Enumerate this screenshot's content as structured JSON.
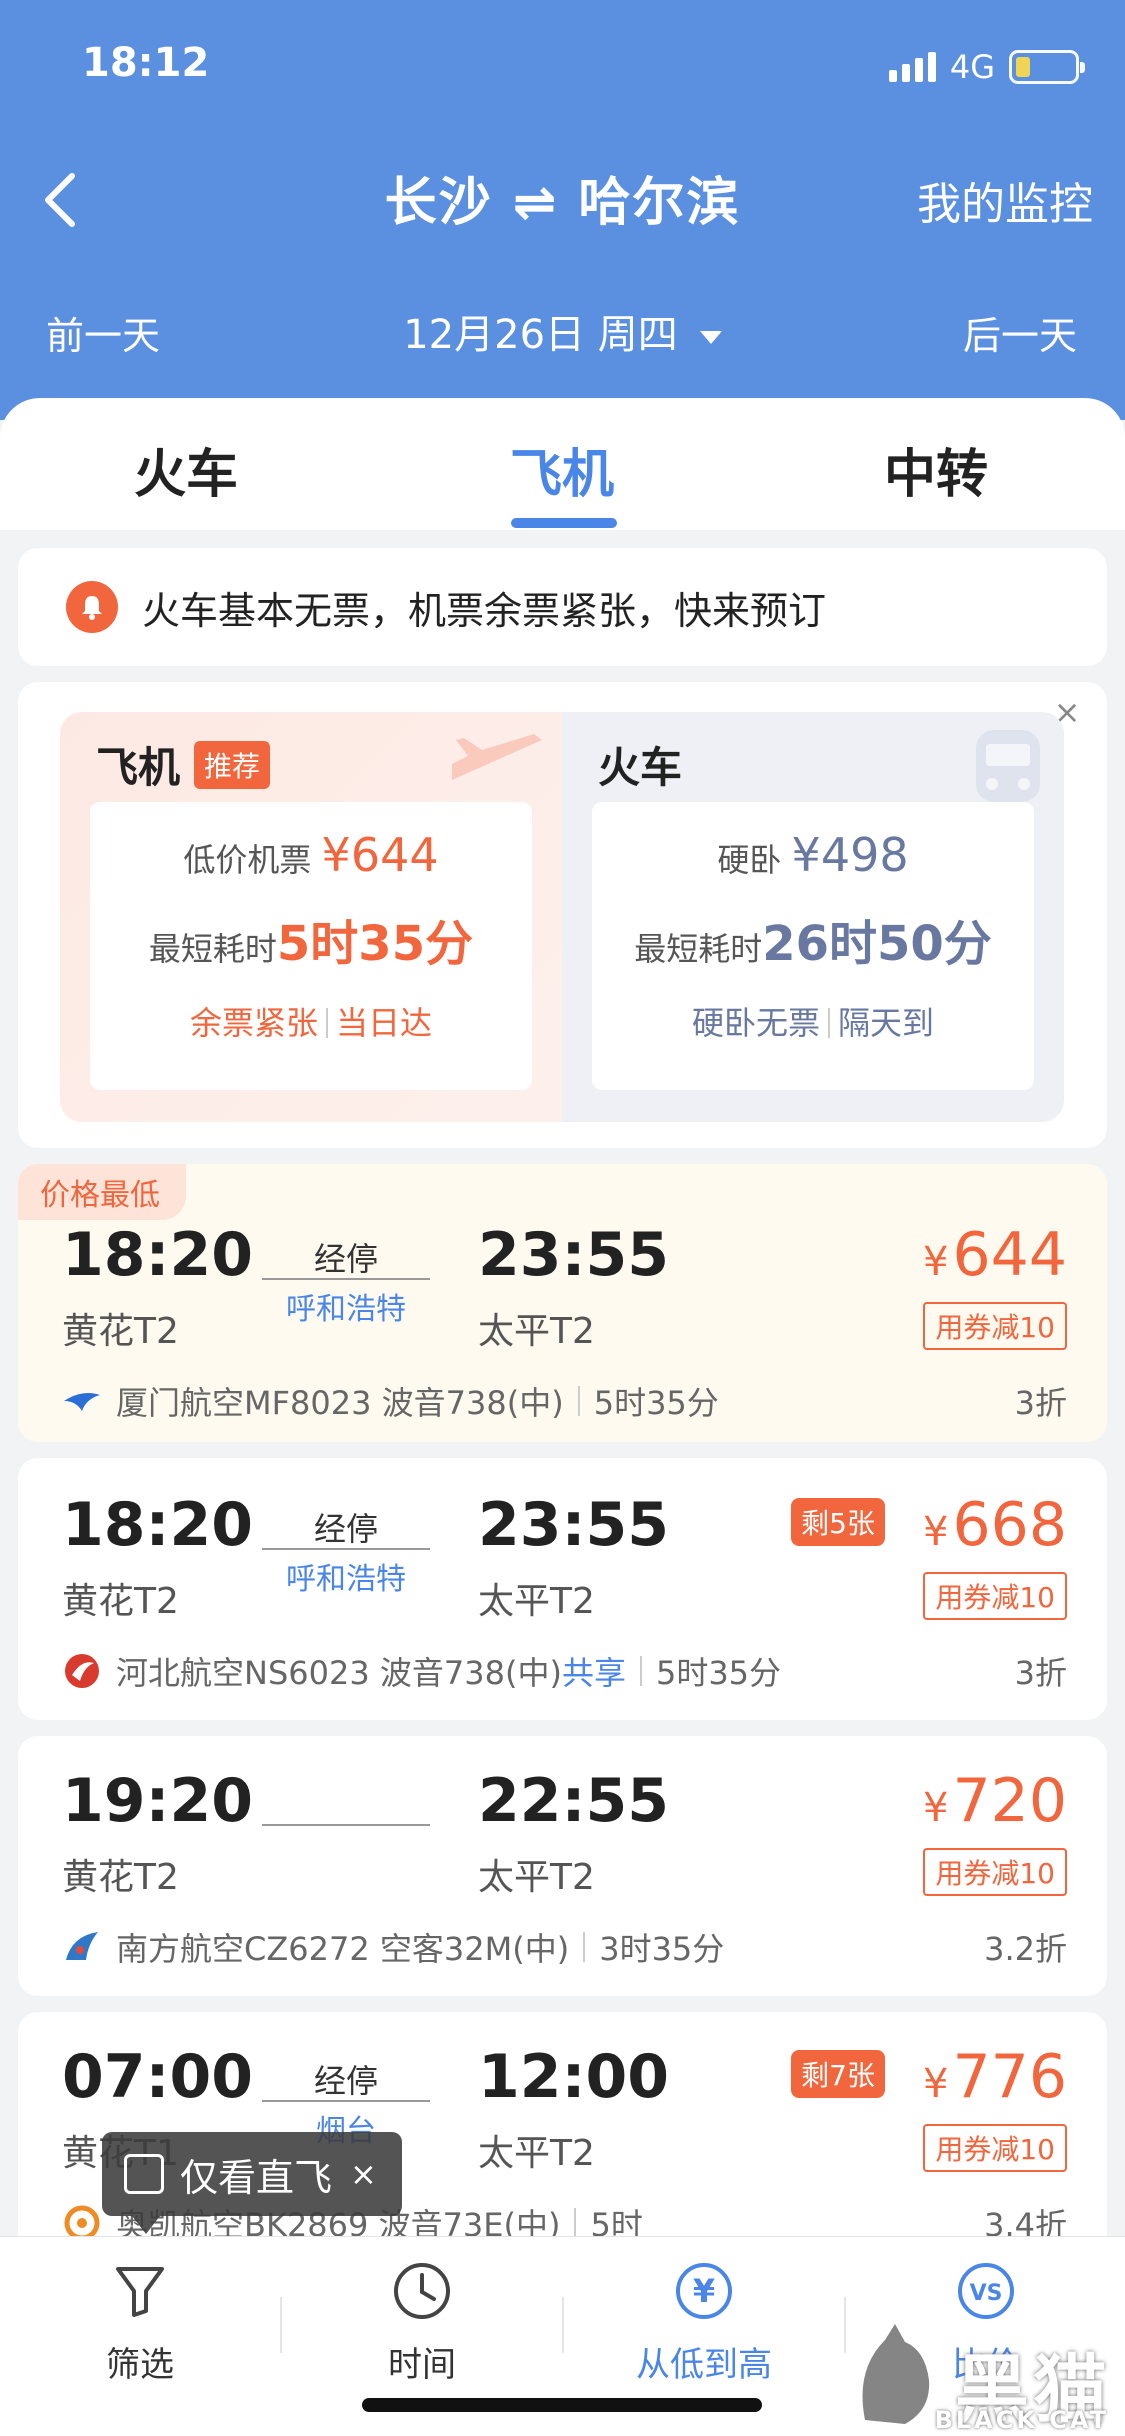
{
  "status": {
    "time": "18:12",
    "network": "4G"
  },
  "header": {
    "title": "长沙 ⇌ 哈尔滨",
    "monitor": "我的监控",
    "prev_day": "前一天",
    "date": "12月26日 周四",
    "next_day": "后一天"
  },
  "tabs": [
    {
      "label": "火车"
    },
    {
      "label": "飞机"
    },
    {
      "label": "中转"
    }
  ],
  "active_tab": "飞机",
  "notice": "火车基本无票，机票余票紧张，快来预订",
  "compare": {
    "plane": {
      "title": "飞机",
      "badge": "推荐",
      "price_label": "低价机票",
      "price": "¥644",
      "time_label": "最短耗时",
      "time": "5时35分",
      "tag1": "余票紧张",
      "tag2": "当日达"
    },
    "train": {
      "title": "火车",
      "price_label": "硬卧",
      "price": "¥498",
      "time_label": "最短耗时",
      "time": "26时50分",
      "tag1": "硬卧无票",
      "tag2": "隔天到"
    }
  },
  "lowest_tag": "价格最低",
  "flights": [
    {
      "dep_time": "18:20",
      "dep_term": "黄花T2",
      "stop_label": "经停",
      "stop_city": "呼和浩特",
      "arr_time": "23:55",
      "arr_term": "太平T2",
      "price": "644",
      "remain": "",
      "coupon": "用券减10",
      "airline": "厦门航空MF8023",
      "aircraft": "波音738(中)",
      "share": "",
      "duration": "5时35分",
      "discount": "3折"
    },
    {
      "dep_time": "18:20",
      "dep_term": "黄花T2",
      "stop_label": "经停",
      "stop_city": "呼和浩特",
      "arr_time": "23:55",
      "arr_term": "太平T2",
      "price": "668",
      "remain": "剩5张",
      "coupon": "用券减10",
      "airline": "河北航空NS6023",
      "aircraft": "波音738(中)",
      "share": "共享",
      "duration": "5时35分",
      "discount": "3折"
    },
    {
      "dep_time": "19:20",
      "dep_term": "黄花T2",
      "stop_label": "",
      "stop_city": "",
      "arr_time": "22:55",
      "arr_term": "太平T2",
      "price": "720",
      "remain": "",
      "coupon": "用券减10",
      "airline": "南方航空CZ6272",
      "aircraft": "空客32M(中)",
      "share": "",
      "duration": "3时35分",
      "discount": "3.2折"
    },
    {
      "dep_time": "07:00",
      "dep_term": "黄花T1",
      "stop_label": "经停",
      "stop_city": "烟台",
      "arr_time": "12:00",
      "arr_term": "太平T2",
      "price": "776",
      "remain": "剩7张",
      "coupon": "用券减10",
      "airline": "奥凯航空BK2869",
      "aircraft": "波音73E(中)",
      "share": "",
      "duration": "5时",
      "discount": "3.4折"
    }
  ],
  "currency": "¥",
  "direct_only": "仅看直飞",
  "bottom_bar": [
    {
      "label": "筛选",
      "icon": "filter-icon"
    },
    {
      "label": "时间",
      "icon": "clock-icon"
    },
    {
      "label": "从低到高",
      "icon": "yen-icon"
    },
    {
      "label": "比价",
      "icon": "vs-icon"
    }
  ],
  "watermark": {
    "text": "黑猫",
    "sub": "BLACK CAT"
  },
  "colors": {
    "header_bg": "#5b8fdf",
    "accent_blue": "#4a86e8",
    "accent_red": "#f2663e"
  }
}
